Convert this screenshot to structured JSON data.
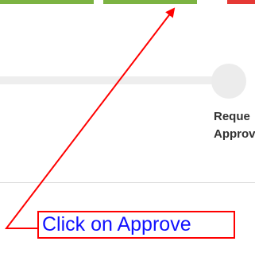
{
  "buttons": {
    "first_color": "#7cb342",
    "approve_color": "#7cb342",
    "reject_color": "#e53935"
  },
  "progress": {
    "step_label_line1": "Reque",
    "step_label_line2": "Approv"
  },
  "annotation": {
    "text": "Click on Approve",
    "border_color": "#ff0000",
    "text_color": "#1111ff"
  }
}
